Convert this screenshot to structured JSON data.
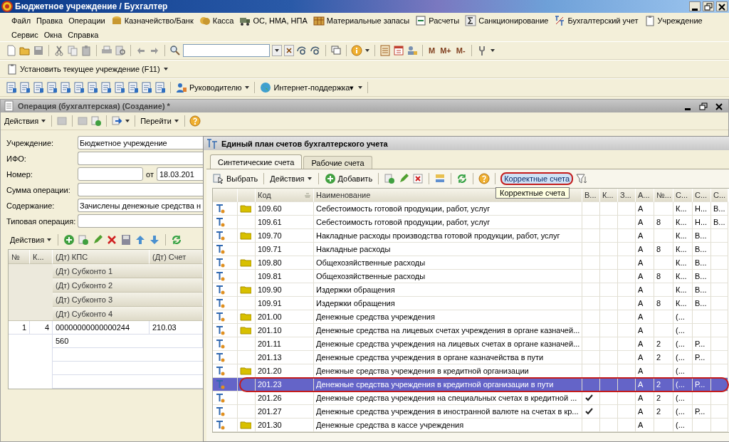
{
  "window": {
    "title": "Бюджетное учреждение / Бухгалтер"
  },
  "menu": [
    {
      "label": "Файл",
      "kind": "plain"
    },
    {
      "label": "Правка",
      "kind": "plain"
    },
    {
      "label": "Операции",
      "kind": "plain"
    },
    {
      "label": "Казначейство/Банк",
      "kind": "bank"
    },
    {
      "label": "Касса",
      "kind": "cash"
    },
    {
      "label": "ОС, НМА, НПА",
      "kind": "truck"
    },
    {
      "label": "Материальные запасы",
      "kind": "box"
    },
    {
      "label": "Расчеты",
      "kind": "card"
    },
    {
      "label": "Санкционирование",
      "kind": "sigma"
    },
    {
      "label": "Бухгалтерский учет",
      "kind": "ledger"
    },
    {
      "label": "Учреждение",
      "kind": "clipboard"
    },
    {
      "label": "Сервис",
      "kind": "plain"
    },
    {
      "label": "Окна",
      "kind": "plain"
    },
    {
      "label": "Справка",
      "kind": "plain"
    }
  ],
  "toolbar": {
    "memory_buttons": [
      "M",
      "M+",
      "M-"
    ]
  },
  "institution_bar": {
    "label": "Установить текущее учреждение (F11)"
  },
  "reports_bar": {
    "items": [
      {
        "label": "Руководителю",
        "kind": "person"
      },
      {
        "label": "Интернет-поддержка▾",
        "kind": "globe"
      }
    ]
  },
  "operation_window": {
    "title": "Операция (бухгалтерская) (Создание) *",
    "toolbar": {
      "actions": "Действия",
      "goto": "Перейти"
    },
    "fields": [
      {
        "label": "Учреждение:",
        "value": "Бюджетное учреждение"
      },
      {
        "label": "ИФО:"
      },
      {
        "label": "Номер:",
        "kind": "number",
        "date_label": "от",
        "date": "18.03.201"
      },
      {
        "label": "Сумма операции:"
      },
      {
        "label": "Содержание:",
        "value": "Зачислены денежные средства н"
      },
      {
        "label": "Типовая операция:"
      }
    ],
    "table_actions": "Действия",
    "table": {
      "columns": [
        "№",
        "К...",
        "(Дт) КПС",
        "(Дт) Счет"
      ],
      "sub_columns": [
        "(Дт) Субконто 1",
        "(Дт) Субконто 2",
        "(Дт) Субконто 3",
        "(Дт) Субконто 4"
      ],
      "rows": [
        {
          "n": "1",
          "k": "4",
          "kps": "00000000000000244",
          "account": "210.03",
          "subconto_1": "560"
        }
      ]
    }
  },
  "chart_of_accounts": {
    "title": "Единый план счетов бухгалтерского учета",
    "tabs": [
      {
        "label": "Синтетические счета",
        "selected": true
      },
      {
        "label": "Рабочие счета",
        "selected": false
      }
    ],
    "toolbar": {
      "select": "Выбрать",
      "actions": "Действия",
      "add": "Добавить",
      "correct": "Корректные счета"
    },
    "tooltip": "Корректные счета",
    "columns": [
      "Код",
      "Наименование",
      "В...",
      "К...",
      "З...",
      "А...",
      "№...",
      "С...",
      "С...",
      "С..."
    ],
    "rows": [
      {
        "folder": true,
        "code": "109.60",
        "name": "Себестоимость готовой продукции, работ, услуг",
        "checked": false,
        "a": "А",
        "n": "",
        "c1": "К...",
        "c2": "Н...",
        "c3": "В...",
        "selected": false
      },
      {
        "folder": false,
        "code": "109.61",
        "name": "Себестоимость готовой продукции, работ, услуг",
        "checked": false,
        "a": "А",
        "n": "8",
        "c1": "К...",
        "c2": "Н...",
        "c3": "В...",
        "selected": false
      },
      {
        "folder": true,
        "code": "109.70",
        "name": "Накладные расходы производства готовой продукции, работ, услуг",
        "checked": false,
        "a": "А",
        "n": "",
        "c1": "К...",
        "c2": "В...",
        "c3": "",
        "selected": false
      },
      {
        "folder": false,
        "code": "109.71",
        "name": "Накладные расходы",
        "checked": false,
        "a": "А",
        "n": "8",
        "c1": "К...",
        "c2": "В...",
        "c3": "",
        "selected": false
      },
      {
        "folder": true,
        "code": "109.80",
        "name": "Общехозяйственные расходы",
        "checked": false,
        "a": "А",
        "n": "",
        "c1": "К...",
        "c2": "В...",
        "c3": "",
        "selected": false
      },
      {
        "folder": false,
        "code": "109.81",
        "name": "Общехозяйственные расходы",
        "checked": false,
        "a": "А",
        "n": "8",
        "c1": "К...",
        "c2": "В...",
        "c3": "",
        "selected": false
      },
      {
        "folder": true,
        "code": "109.90",
        "name": "Издержки обращения",
        "checked": false,
        "a": "А",
        "n": "",
        "c1": "К...",
        "c2": "В...",
        "c3": "",
        "selected": false
      },
      {
        "folder": false,
        "code": "109.91",
        "name": "Издержки обращения",
        "checked": false,
        "a": "А",
        "n": "8",
        "c1": "К...",
        "c2": "В...",
        "c3": "",
        "selected": false
      },
      {
        "folder": true,
        "code": "201.00",
        "name": "Денежные средства учреждения",
        "checked": false,
        "a": "А",
        "n": "",
        "c1": "(...",
        "c2": "",
        "c3": "",
        "selected": false
      },
      {
        "folder": true,
        "code": "201.10",
        "name": "Денежные средства на лицевых счетах учреждения в органе казначей...",
        "checked": false,
        "a": "А",
        "n": "",
        "c1": "(...",
        "c2": "",
        "c3": "",
        "selected": false
      },
      {
        "folder": false,
        "code": "201.11",
        "name": "Денежные средства учреждения на лицевых счетах в органе казначей...",
        "checked": false,
        "a": "А",
        "n": "2",
        "c1": "(...",
        "c2": "Р...",
        "c3": "",
        "selected": false
      },
      {
        "folder": false,
        "code": "201.13",
        "name": "Денежные средства учреждения в органе казначейства в пути",
        "checked": false,
        "a": "А",
        "n": "2",
        "c1": "(...",
        "c2": "Р...",
        "c3": "",
        "selected": false
      },
      {
        "folder": true,
        "code": "201.20",
        "name": "Денежные средства учреждения в кредитной организации",
        "checked": false,
        "a": "А",
        "n": "",
        "c1": "(...",
        "c2": "",
        "c3": "",
        "selected": false
      },
      {
        "folder": false,
        "code": "201.23",
        "name": "Денежные средства учреждения в кредитной организации в пути",
        "checked": false,
        "a": "А",
        "n": "2",
        "c1": "(...",
        "c2": "Р...",
        "c3": "",
        "selected": true
      },
      {
        "folder": false,
        "code": "201.26",
        "name": "Денежные средства учреждения на специальных счетах в кредитной ...",
        "checked": true,
        "a": "А",
        "n": "2",
        "c1": "(...",
        "c2": "",
        "c3": "",
        "selected": false
      },
      {
        "folder": false,
        "code": "201.27",
        "name": "Денежные средства учреждения в иностранной валюте на счетах в кр...",
        "checked": true,
        "a": "А",
        "n": "2",
        "c1": "(...",
        "c2": "Р...",
        "c3": "",
        "selected": false
      },
      {
        "folder": true,
        "code": "201.30",
        "name": "Денежные средства  в кассе учреждения",
        "checked": false,
        "a": "А",
        "n": "",
        "c1": "(...",
        "c2": "",
        "c3": "",
        "selected": false
      }
    ]
  }
}
